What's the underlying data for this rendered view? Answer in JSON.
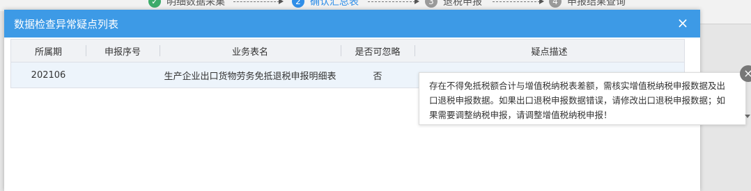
{
  "background": {
    "steps": [
      {
        "number": "✓",
        "label": "明细数据采集",
        "state": "done"
      },
      {
        "number": "2",
        "label": "确认汇总表",
        "state": "active"
      },
      {
        "number": "3",
        "label": "退税申报",
        "state": "pending"
      },
      {
        "number": "4",
        "label": "申报结果查询",
        "state": "pending"
      }
    ]
  },
  "dialog": {
    "title": "数据检查异常疑点列表",
    "close_icon": "×",
    "table": {
      "columns": [
        "所属期",
        "申报序号",
        "业务表名",
        "是否可忽略",
        "疑点描述"
      ],
      "rows": [
        {
          "period": "202106",
          "seq": "",
          "table_name": "生产企业出口货物劳务免抵退税申报明细表",
          "ignorable": "否",
          "description": ""
        }
      ]
    }
  },
  "tooltip": {
    "text": "存在不得免抵税额合计与增值税纳税表差额，需核实增值税纳税申报数据及出口退税申报数据。如果出口退税申报数据错误，请修改出口退税申报数据；如果需要调整纳税申报，请调整增值税纳税申报！",
    "close_icon": "×"
  },
  "colors": {
    "header": "#3d9ae6",
    "active_step": "#2f8ee8",
    "done_step": "#3cab6a",
    "row_bg": "#edf4fb"
  }
}
